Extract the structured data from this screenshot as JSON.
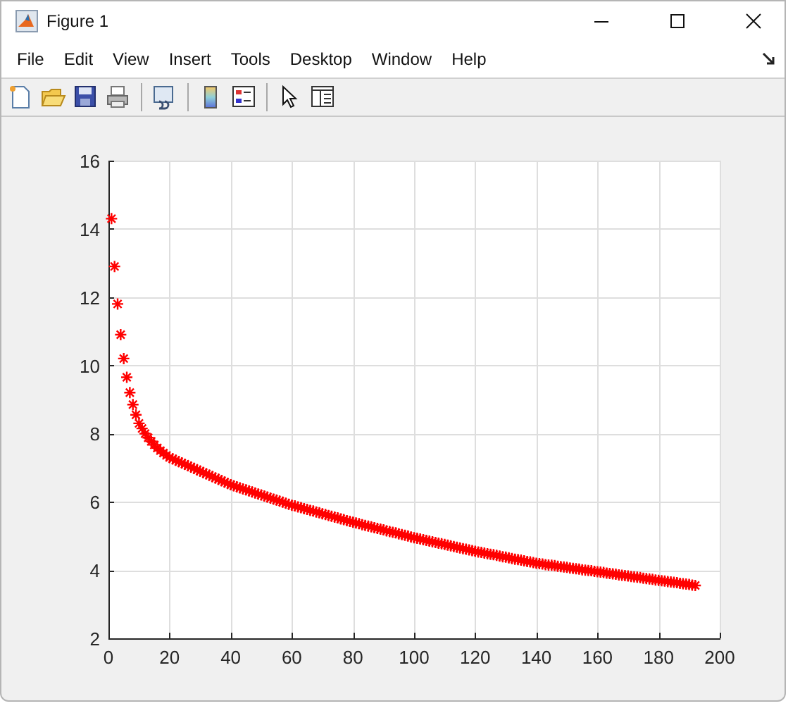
{
  "window": {
    "title": "Figure 1"
  },
  "menu": [
    {
      "label": "File"
    },
    {
      "label": "Edit"
    },
    {
      "label": "View"
    },
    {
      "label": "Insert"
    },
    {
      "label": "Tools"
    },
    {
      "label": "Desktop"
    },
    {
      "label": "Window"
    },
    {
      "label": "Help"
    }
  ],
  "toolbar": [
    {
      "kind": "new"
    },
    {
      "kind": "open"
    },
    {
      "kind": "save"
    },
    {
      "kind": "print"
    },
    {
      "kind": "separator"
    },
    {
      "kind": "link"
    },
    {
      "kind": "separator"
    },
    {
      "kind": "colorbar"
    },
    {
      "kind": "legend"
    },
    {
      "kind": "separator"
    },
    {
      "kind": "pointer"
    },
    {
      "kind": "panel"
    }
  ],
  "figure": {
    "chart_data": {
      "type": "scatter",
      "grid": true,
      "xlim": [
        0,
        200
      ],
      "ylim": [
        2,
        16
      ],
      "xticks": [
        0,
        20,
        40,
        60,
        80,
        100,
        120,
        140,
        160,
        180,
        200
      ],
      "yticks": [
        2,
        4,
        6,
        8,
        10,
        12,
        14,
        16
      ],
      "x": [
        1,
        2,
        3,
        4,
        5,
        6,
        7,
        8,
        9,
        10,
        11,
        12,
        13,
        14,
        15,
        16,
        17,
        18,
        19,
        20,
        21,
        22,
        23,
        24,
        25,
        26,
        27,
        28,
        29,
        30,
        31,
        32,
        33,
        34,
        35,
        36,
        37,
        38,
        39,
        40,
        41,
        42,
        43,
        44,
        45,
        46,
        47,
        48,
        49,
        50,
        51,
        52,
        53,
        54,
        55,
        56,
        57,
        58,
        59,
        60,
        61,
        62,
        63,
        64,
        65,
        66,
        67,
        68,
        69,
        70,
        71,
        72,
        73,
        74,
        75,
        76,
        77,
        78,
        79,
        80,
        81,
        82,
        83,
        84,
        85,
        86,
        87,
        88,
        89,
        90,
        91,
        92,
        93,
        94,
        95,
        96,
        97,
        98,
        99,
        100,
        101,
        102,
        103,
        104,
        105,
        106,
        107,
        108,
        109,
        110,
        111,
        112,
        113,
        114,
        115,
        116,
        117,
        118,
        119,
        120,
        121,
        122,
        123,
        124,
        125,
        126,
        127,
        128,
        129,
        130,
        131,
        132,
        133,
        134,
        135,
        136,
        137,
        138,
        139,
        140,
        141,
        142,
        143,
        144,
        145,
        146,
        147,
        148,
        149,
        150,
        151,
        152,
        153,
        154,
        155,
        156,
        157,
        158,
        159,
        160,
        161,
        162,
        163,
        164,
        165,
        166,
        167,
        168,
        169,
        170,
        171,
        172,
        173,
        174,
        175,
        176,
        177,
        178,
        179,
        180,
        181,
        182,
        183,
        184,
        185,
        186,
        187,
        188,
        189,
        190,
        191,
        192
      ],
      "series": [
        {
          "color": "#ff0000",
          "values": [
            14.3,
            12.9,
            11.8,
            10.9,
            10.2,
            9.65,
            9.2,
            8.85,
            8.55,
            8.3,
            8.15,
            8.0,
            7.88,
            7.77,
            7.67,
            7.58,
            7.5,
            7.43,
            7.36,
            7.3,
            7.26,
            7.22,
            7.18,
            7.14,
            7.1,
            7.06,
            7.02,
            6.98,
            6.94,
            6.9,
            6.86,
            6.82,
            6.78,
            6.74,
            6.7,
            6.66,
            6.62,
            6.58,
            6.54,
            6.5,
            6.47,
            6.44,
            6.41,
            6.38,
            6.35,
            6.32,
            6.29,
            6.26,
            6.23,
            6.2,
            6.17,
            6.14,
            6.11,
            6.08,
            6.05,
            6.02,
            5.99,
            5.96,
            5.93,
            5.9,
            5.88,
            5.85,
            5.83,
            5.8,
            5.78,
            5.75,
            5.73,
            5.7,
            5.68,
            5.65,
            5.63,
            5.6,
            5.58,
            5.55,
            5.53,
            5.5,
            5.48,
            5.45,
            5.43,
            5.4,
            5.38,
            5.36,
            5.33,
            5.31,
            5.29,
            5.27,
            5.24,
            5.22,
            5.2,
            5.18,
            5.15,
            5.13,
            5.11,
            5.09,
            5.06,
            5.04,
            5.02,
            5.0,
            4.97,
            4.95,
            4.93,
            4.91,
            4.89,
            4.87,
            4.85,
            4.83,
            4.81,
            4.79,
            4.77,
            4.75,
            4.73,
            4.71,
            4.69,
            4.67,
            4.65,
            4.63,
            4.61,
            4.59,
            4.57,
            4.55,
            4.53,
            4.52,
            4.5,
            4.48,
            4.46,
            4.45,
            4.43,
            4.41,
            4.39,
            4.38,
            4.36,
            4.34,
            4.32,
            4.31,
            4.29,
            4.27,
            4.25,
            4.24,
            4.22,
            4.2,
            4.19,
            4.18,
            4.16,
            4.15,
            4.14,
            4.13,
            4.11,
            4.1,
            4.09,
            4.08,
            4.06,
            4.05,
            4.04,
            4.03,
            4.01,
            4.0,
            3.99,
            3.98,
            3.96,
            3.95,
            3.94,
            3.93,
            3.91,
            3.9,
            3.89,
            3.88,
            3.86,
            3.85,
            3.84,
            3.83,
            3.81,
            3.8,
            3.79,
            3.78,
            3.76,
            3.75,
            3.74,
            3.73,
            3.71,
            3.7,
            3.69,
            3.68,
            3.66,
            3.65,
            3.64,
            3.63,
            3.61,
            3.6,
            3.59,
            3.58,
            3.56,
            3.55
          ]
        }
      ]
    }
  }
}
